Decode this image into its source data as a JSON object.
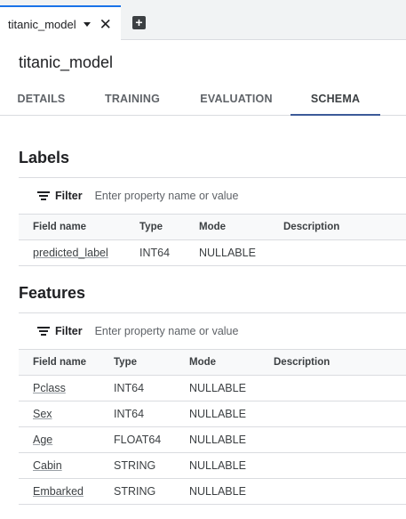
{
  "tab": {
    "label": "titanic_model"
  },
  "page_title": "titanic_model",
  "subtabs": [
    {
      "label": "DETAILS",
      "active": false
    },
    {
      "label": "TRAINING",
      "active": false
    },
    {
      "label": "EVALUATION",
      "active": false
    },
    {
      "label": "SCHEMA",
      "active": true
    }
  ],
  "labels": {
    "title": "Labels",
    "filter_label": "Filter",
    "filter_placeholder": "Enter property name or value",
    "columns": [
      "Field name",
      "Type",
      "Mode",
      "Description"
    ],
    "rows": [
      {
        "field": "predicted_label",
        "type": "INT64",
        "mode": "NULLABLE",
        "description": ""
      }
    ]
  },
  "features": {
    "title": "Features",
    "filter_label": "Filter",
    "filter_placeholder": "Enter property name or value",
    "columns": [
      "Field name",
      "Type",
      "Mode",
      "Description"
    ],
    "rows": [
      {
        "field": "Pclass",
        "type": "INT64",
        "mode": "NULLABLE",
        "description": ""
      },
      {
        "field": "Sex",
        "type": "INT64",
        "mode": "NULLABLE",
        "description": ""
      },
      {
        "field": "Age",
        "type": "FLOAT64",
        "mode": "NULLABLE",
        "description": ""
      },
      {
        "field": "Cabin",
        "type": "STRING",
        "mode": "NULLABLE",
        "description": ""
      },
      {
        "field": "Embarked",
        "type": "STRING",
        "mode": "NULLABLE",
        "description": ""
      }
    ]
  }
}
